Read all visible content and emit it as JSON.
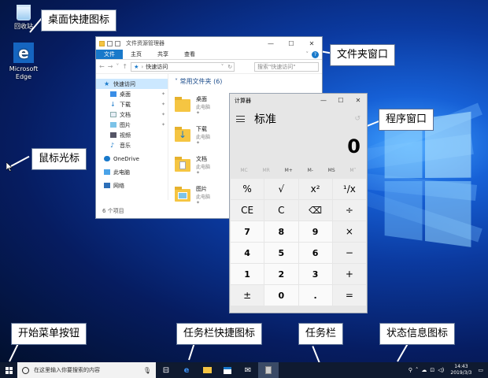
{
  "desktop": {
    "icons": [
      {
        "label": "回收站",
        "icon": "recycle-bin-icon"
      },
      {
        "label": "Microsoft Edge",
        "icon": "edge-icon"
      }
    ]
  },
  "callouts": {
    "desktop_shortcut": "桌面快捷图标",
    "folder_window": "文件夹窗口",
    "program_window": "程序窗口",
    "mouse_pointer": "鼠标光标",
    "start_button": "开始菜单按钮",
    "taskbar_shortcuts": "任务栏快捷图标",
    "taskbar": "任务栏",
    "status_icons": "状态信息图标"
  },
  "explorer": {
    "title": "文件资源管理器",
    "ribbon_tabs": [
      "文件",
      "主页",
      "共享",
      "查看"
    ],
    "address": "快速访问",
    "search_placeholder": "搜索\"快速访问\"",
    "nav": [
      {
        "label": "快速访问",
        "icon": "star-icon"
      },
      {
        "label": "桌面",
        "icon": "desktop-icon"
      },
      {
        "label": "下载",
        "icon": "download-icon"
      },
      {
        "label": "文档",
        "icon": "document-icon"
      },
      {
        "label": "图片",
        "icon": "picture-icon"
      },
      {
        "label": "视频",
        "icon": "video-icon"
      },
      {
        "label": "音乐",
        "icon": "music-icon"
      },
      {
        "label": "OneDrive",
        "icon": "cloud-icon"
      },
      {
        "label": "此电脑",
        "icon": "computer-icon"
      },
      {
        "label": "网络",
        "icon": "network-icon"
      }
    ],
    "group_title": "常用文件夹 (6)",
    "folders": [
      {
        "name": "桌面",
        "sub": "此电脑"
      },
      {
        "name": "下载",
        "sub": "此电脑"
      },
      {
        "name": "文档",
        "sub": "此电脑"
      },
      {
        "name": "图片",
        "sub": "此电脑"
      }
    ],
    "status": "6 个项目"
  },
  "calculator": {
    "title": "计算器",
    "mode": "标准",
    "display": "0",
    "memory": [
      "MC",
      "MR",
      "M+",
      "M-",
      "MS",
      "M˅"
    ],
    "keys": [
      "%",
      "√",
      "x²",
      "¹/x",
      "CE",
      "C",
      "⌫",
      "÷",
      "7",
      "8",
      "9",
      "×",
      "4",
      "5",
      "6",
      "−",
      "1",
      "2",
      "3",
      "+",
      "±",
      "0",
      ".",
      "="
    ]
  },
  "taskbar": {
    "search_placeholder": "在这里输入你要搜索的内容",
    "time": "14:43",
    "date": "2019/3/3"
  },
  "colors": {
    "accent": "#1979ca",
    "taskbar": "#0f1a30"
  }
}
